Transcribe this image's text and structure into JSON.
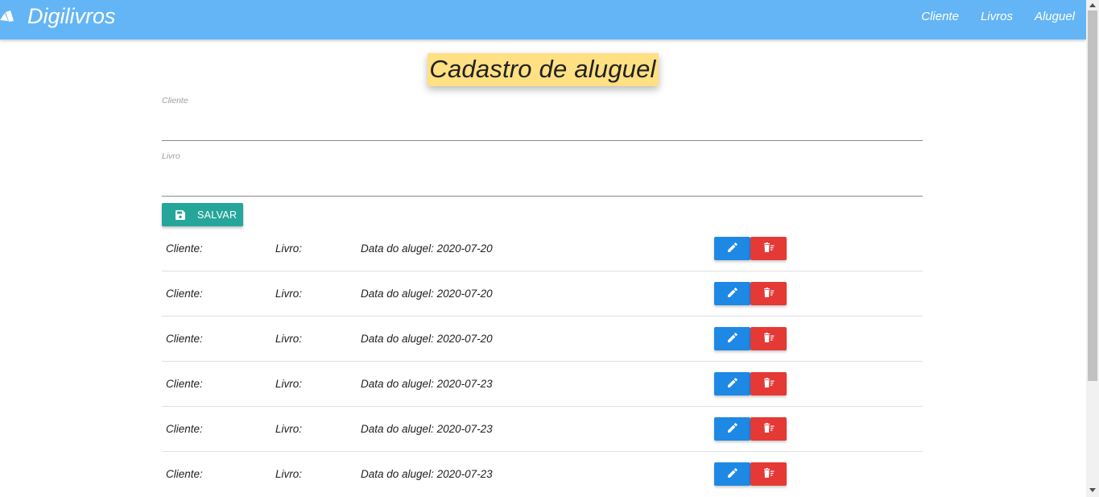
{
  "navbar": {
    "brand": "Digilivros",
    "brand_icon": "books-icon",
    "links": [
      "Cliente",
      "Livros",
      "Aluguel"
    ]
  },
  "page": {
    "title": "Cadastro de aluguel"
  },
  "form": {
    "cliente_label": "Cliente",
    "cliente_value": "",
    "livro_label": "Livro",
    "livro_value": "",
    "save_label": "SALVAR",
    "save_icon": "floppy-disk-icon"
  },
  "rentals": [
    {
      "cliente": "Cliente:",
      "livro": "Livro:",
      "data": "Data do alugel: 2020-07-20"
    },
    {
      "cliente": "Cliente:",
      "livro": "Livro:",
      "data": "Data do alugel: 2020-07-20"
    },
    {
      "cliente": "Cliente:",
      "livro": "Livro:",
      "data": "Data do alugel: 2020-07-20"
    },
    {
      "cliente": "Cliente:",
      "livro": "Livro:",
      "data": "Data do alugel: 2020-07-23"
    },
    {
      "cliente": "Cliente:",
      "livro": "Livro:",
      "data": "Data do alugel: 2020-07-23"
    },
    {
      "cliente": "Cliente:",
      "livro": "Livro:",
      "data": "Data do alugel: 2020-07-23"
    }
  ],
  "colors": {
    "navbar": "#64b5f6",
    "title_highlight": "#ffe082",
    "save": "#26a69a",
    "edit": "#1e88e5",
    "delete": "#e53935"
  }
}
